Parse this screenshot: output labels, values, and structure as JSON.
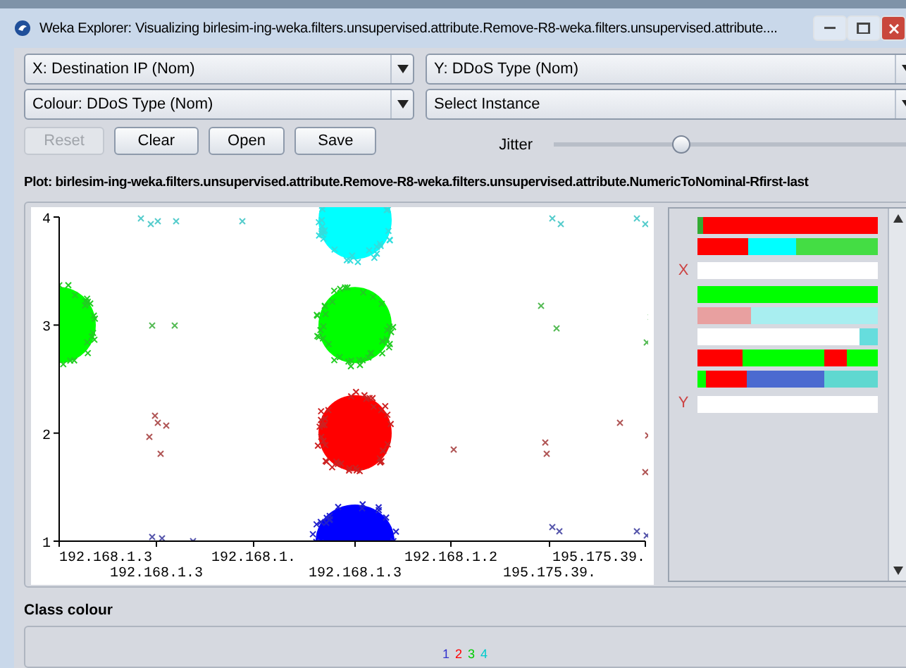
{
  "window": {
    "title": "Weka Explorer: Visualizing birlesim-ing-weka.filters.unsupervised.attribute.Remove-R8-weka.filters.unsupervised.attribute...."
  },
  "selectors": [
    {
      "label": "X: Destination IP (Nom)"
    },
    {
      "label": "Y: DDoS Type (Nom)"
    },
    {
      "label": "Colour: DDoS Type (Nom)"
    },
    {
      "label": "Select Instance"
    }
  ],
  "buttons": [
    {
      "label": "Reset",
      "disabled": true
    },
    {
      "label": "Clear",
      "disabled": false
    },
    {
      "label": "Open",
      "disabled": false
    },
    {
      "label": "Save",
      "disabled": false
    }
  ],
  "jitter": {
    "label": "Jitter",
    "level": 0.36
  },
  "plot": {
    "title": "Plot: birlesim-ing-weka.filters.unsupervised.attribute.Remove-R8-weka.filters.unsupervised.attribute.NumericToNominal-Rfirst-last",
    "y_ticks": [
      "4",
      "3",
      "2",
      "1"
    ],
    "x_labels": [
      "192.168.1.3",
      "192.168.1.3",
      "192.168.1.",
      "192.168.1.3",
      "192.168.1.2",
      "195.175.39.",
      "195.175.39."
    ]
  },
  "attribute_panel": {
    "x_marker": "X",
    "y_marker": "Y",
    "bars": [
      {
        "on_x": false,
        "on_y": false
      },
      {
        "on_x": false,
        "on_y": false
      },
      {
        "on_x": true,
        "on_y": false
      },
      {
        "on_x": false,
        "on_y": false
      },
      {
        "on_x": false,
        "on_y": false
      },
      {
        "on_x": false,
        "on_y": false
      },
      {
        "on_x": false,
        "on_y": false
      },
      {
        "on_x": false,
        "on_y": false
      },
      {
        "on_x": false,
        "on_y": true
      }
    ]
  },
  "class_colour": {
    "title": "Class colour",
    "classes": [
      {
        "label": "1",
        "color": "#3333cc"
      },
      {
        "label": "2",
        "color": "#ff0000"
      },
      {
        "label": "3",
        "color": "#00cc00"
      },
      {
        "label": "4",
        "color": "#00cccc"
      }
    ]
  }
}
